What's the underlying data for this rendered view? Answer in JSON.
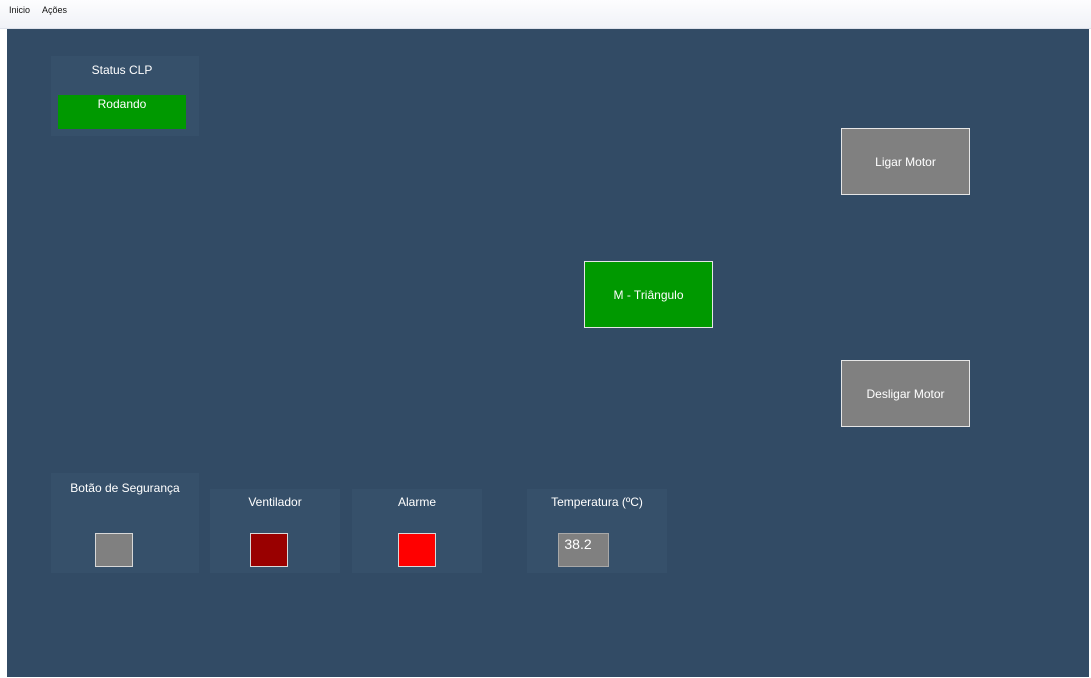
{
  "menu": {
    "items": [
      "Inicio",
      "Ações"
    ]
  },
  "status_clp": {
    "title": "Status CLP",
    "value": "Rodando",
    "color": "#009900"
  },
  "motor_mode": {
    "label": "M - Triângulo",
    "color": "#009900"
  },
  "buttons": {
    "ligar": "Ligar Motor",
    "desligar": "Desligar Motor"
  },
  "indicators": {
    "seguranca": {
      "label": "Botão de Segurança",
      "color": "#808080"
    },
    "ventilador": {
      "label": "Ventilador",
      "color": "#990000"
    },
    "alarme": {
      "label": "Alarme",
      "color": "#ff0000"
    }
  },
  "temperatura": {
    "label": "Temperatura (ºC)",
    "value": "38.2"
  },
  "colors": {
    "background": "#324b65",
    "button_gray": "#808080"
  }
}
